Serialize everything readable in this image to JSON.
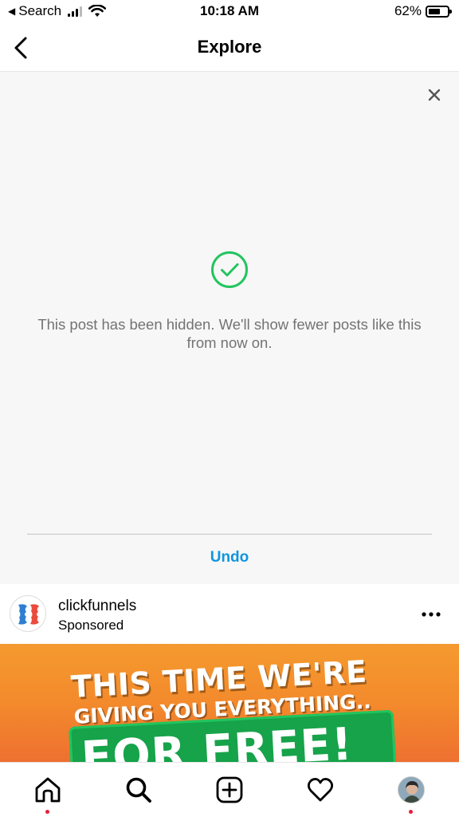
{
  "status_bar": {
    "back_app": "Search",
    "time": "10:18 AM",
    "battery_percent": "62%",
    "battery_level": 0.62
  },
  "header": {
    "title": "Explore"
  },
  "hidden_notice": {
    "message": "This post has been hidden. We'll show fewer posts like this from now on.",
    "undo_label": "Undo",
    "accent_color": "#22c55e",
    "link_color": "#0f95e0"
  },
  "post": {
    "username": "clickfunnels",
    "subtitle": "Sponsored",
    "ad_text": {
      "line1": "THIS TIME WE'RE",
      "line2": "GIVING YOU EVERYTHING..",
      "line3": "FOR FREE!"
    }
  },
  "bottom_nav": {
    "items": [
      "home-icon",
      "search-icon",
      "create-icon",
      "activity-icon",
      "profile-avatar"
    ],
    "notification_color": "#ed1a3a"
  }
}
